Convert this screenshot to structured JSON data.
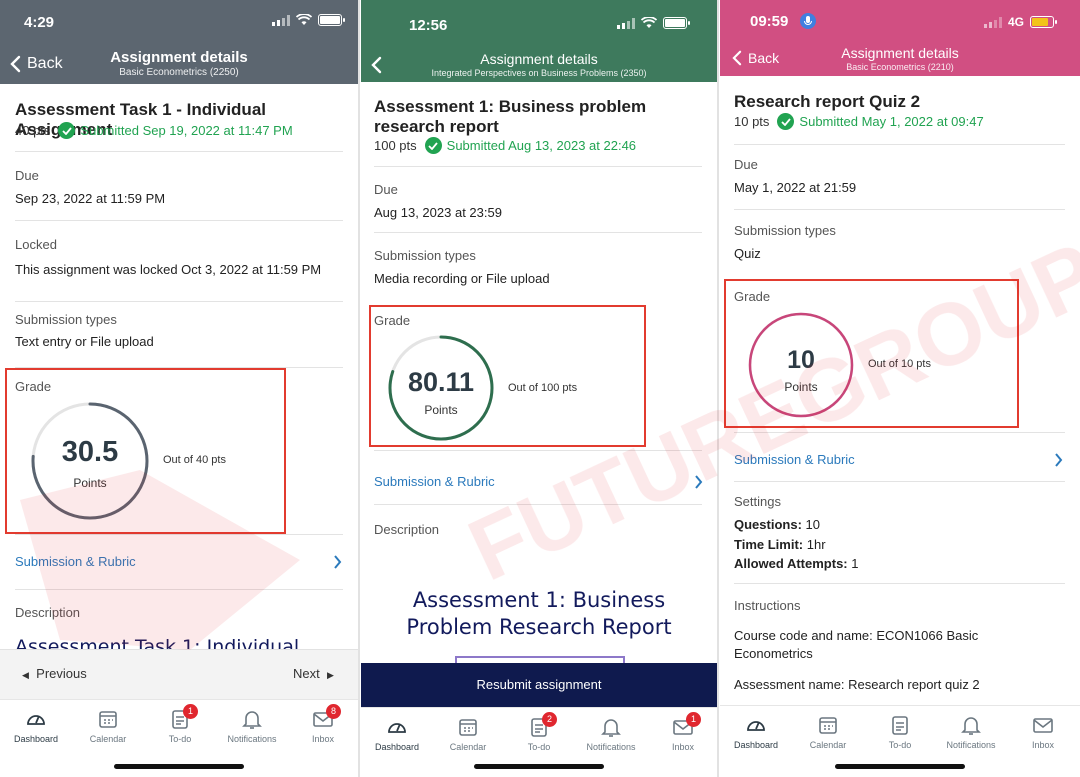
{
  "phone1": {
    "status": {
      "time": "4:29"
    },
    "header": {
      "back": "Back",
      "title": "Assignment details",
      "subtitle": "Basic Econometrics (2250)"
    },
    "assignment": {
      "title": "Assessment Task 1 - Individual Assignment",
      "points": "40 pts",
      "submitted": "Submitted Sep 19, 2022 at 11:47 PM"
    },
    "due": {
      "label": "Due",
      "value": "Sep 23, 2022 at 11:59 PM"
    },
    "locked": {
      "label": "Locked",
      "value": "This assignment was locked Oct 3, 2022 at 11:59 PM"
    },
    "submission_types": {
      "label": "Submission types",
      "value": "Text entry or File upload"
    },
    "grade": {
      "label": "Grade",
      "score": "30.5",
      "unit": "Points",
      "out_of": "Out of 40 pts",
      "fraction": 0.7625
    },
    "rubric_link": "Submission & Rubric",
    "description": {
      "label": "Description",
      "preview": "Assessment Task 1: Individual"
    },
    "nav": {
      "previous": "Previous",
      "next": "Next"
    },
    "tabs": [
      {
        "label": "Dashboard"
      },
      {
        "label": "Calendar"
      },
      {
        "label": "To-do",
        "badge": "1"
      },
      {
        "label": "Notifications"
      },
      {
        "label": "Inbox",
        "badge": "8"
      }
    ]
  },
  "phone2": {
    "status": {
      "time": "12:56"
    },
    "header": {
      "title": "Assignment details",
      "subtitle": "Integrated Perspectives on Business Problems (2350)"
    },
    "assignment": {
      "title_line1": "Assessment 1: Business problem",
      "title_line2": "research report",
      "points": "100 pts",
      "submitted": "Submitted Aug 13, 2023 at 22:46"
    },
    "due": {
      "label": "Due",
      "value": "Aug 13, 2023 at 23:59"
    },
    "submission_types": {
      "label": "Submission types",
      "value": "Media recording or File upload"
    },
    "grade": {
      "label": "Grade",
      "score": "80.11",
      "unit": "Points",
      "out_of": "Out of 100 pts",
      "fraction": 0.8011
    },
    "rubric_link": "Submission & Rubric",
    "description": {
      "label": "Description",
      "heading_line1": "Assessment 1: Business",
      "heading_line2": "Problem Research Report"
    },
    "resubmit": "Resubmit assignment",
    "tabs": [
      {
        "label": "Dashboard"
      },
      {
        "label": "Calendar"
      },
      {
        "label": "To-do",
        "badge": "2"
      },
      {
        "label": "Notifications"
      },
      {
        "label": "Inbox",
        "badge": "1"
      }
    ]
  },
  "phone3": {
    "status": {
      "time": "09:59",
      "network": "4G"
    },
    "header": {
      "back": "Back",
      "title": "Assignment details",
      "subtitle": "Basic Econometrics (2210)"
    },
    "assignment": {
      "title": "Research report Quiz 2",
      "points": "10 pts",
      "submitted": "Submitted May 1, 2022 at 09:47"
    },
    "due": {
      "label": "Due",
      "value": "May 1, 2022 at 21:59"
    },
    "submission_types": {
      "label": "Submission types",
      "value": "Quiz"
    },
    "grade": {
      "label": "Grade",
      "score": "10",
      "unit": "Points",
      "out_of": "Out of 10 pts",
      "fraction": 1.0
    },
    "rubric_link": "Submission & Rubric",
    "settings": {
      "label": "Settings",
      "questions_key": "Questions:",
      "questions_val": "10",
      "time_key": "Time Limit:",
      "time_val": "1hr",
      "attempts_key": "Allowed Attempts:",
      "attempts_val": "1"
    },
    "instructions": {
      "label": "Instructions",
      "course_line1": "Course code and name: ECON1066 Basic",
      "course_line2": "Econometrics",
      "assessment_name": "Assessment name: Research report quiz 2"
    },
    "tabs": [
      {
        "label": "Dashboard"
      },
      {
        "label": "Calendar"
      },
      {
        "label": "To-do"
      },
      {
        "label": "Notifications"
      },
      {
        "label": "Inbox"
      }
    ]
  },
  "watermark": {
    "text_cn": "FUTURE GROUP",
    "text_en": "FUTUREGROUP"
  },
  "colors": {
    "red_highlight": "#e23b2f",
    "canvas_link": "#2b7abc",
    "submitted_green": "#21a351",
    "header1": "#5c6670",
    "header2": "#3e7a5d",
    "header3": "#d14f82",
    "ring1": "#5a6470",
    "ring2": "#2e6e4e",
    "ring3": "#c8467a"
  }
}
